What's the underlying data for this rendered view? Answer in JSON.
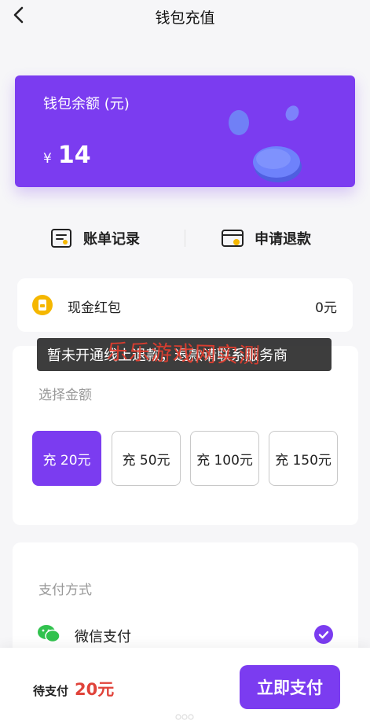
{
  "header": {
    "title": "钱包充值"
  },
  "wallet": {
    "label": "钱包余额 (元)",
    "currency": "¥",
    "balance": "14"
  },
  "actions": {
    "bill": "账单记录",
    "refund": "申请退款"
  },
  "red_packet": {
    "label": "现金红包",
    "value": "0元"
  },
  "amount": {
    "section_title": "选择金额",
    "options": [
      "充 20元",
      "充 50元",
      "充 100元",
      "充 150元"
    ],
    "selected_index": 0
  },
  "toast": {
    "text": "暂未开通线上退款，退款请联系服务商"
  },
  "watermark": {
    "text": "乐乐游戏网实测"
  },
  "payment": {
    "section_title": "支付方式",
    "method": "微信支付",
    "selected": true
  },
  "footer": {
    "due_label": "待支付",
    "due_value": "20元",
    "pay_button": "立即支付"
  },
  "colors": {
    "accent": "#7b3cf0",
    "price": "#e0433a",
    "wechat": "#31c24e",
    "coin_amber": "#f5b700"
  }
}
